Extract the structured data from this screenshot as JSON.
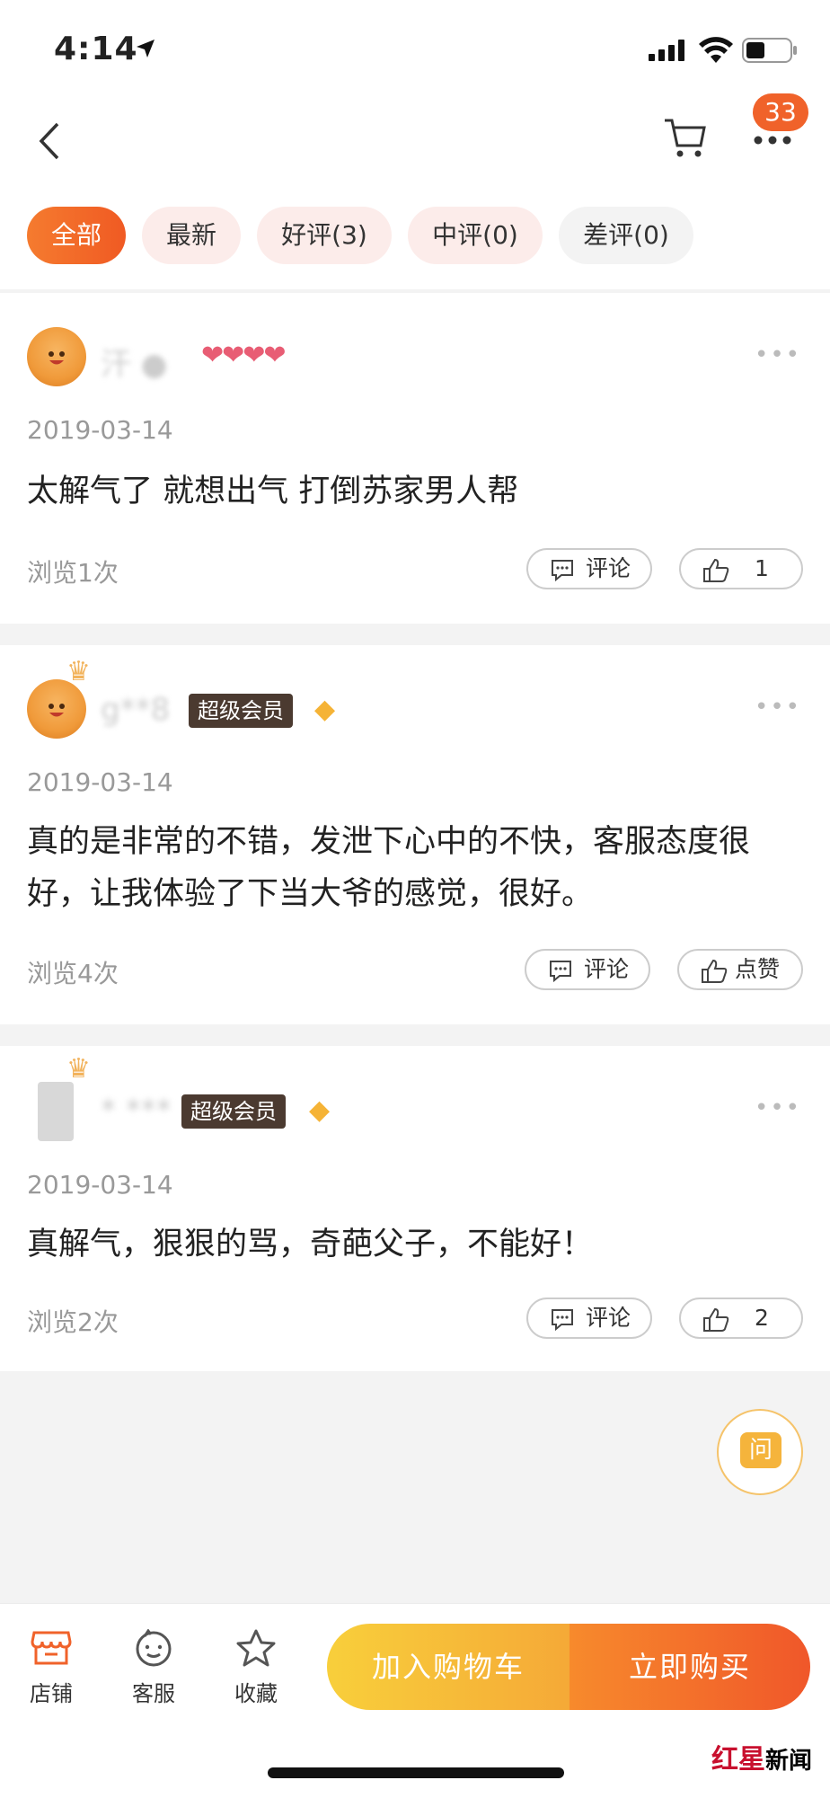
{
  "status": {
    "time": "4:14"
  },
  "nav": {
    "badge": "33"
  },
  "filters": [
    {
      "label": "全部"
    },
    {
      "label": "最新"
    },
    {
      "label": "好评(3)"
    },
    {
      "label": "中评(0)"
    },
    {
      "label": "差评(0)"
    }
  ],
  "reviews": [
    {
      "username": "汗 ●",
      "hearts": "❤❤❤❤",
      "date": "2019-03-14",
      "content": "太解气了 就想出气 打倒苏家男人帮",
      "views": "浏览1次",
      "comment_label": "评论",
      "like_label": "1"
    },
    {
      "username": "g**8",
      "vip": "超级会员",
      "date": "2019-03-14",
      "content": "真的是非常的不错，发泄下心中的不快，客服态度很好，让我体验了下当大爷的感觉，很好。",
      "views": "浏览4次",
      "comment_label": "评论",
      "like_label": "点赞"
    },
    {
      "username": "* ***",
      "vip": "超级会员",
      "date": "2019-03-14",
      "content": "真解气，狠狠的骂，奇葩父子，不能好！",
      "views": "浏览2次",
      "comment_label": "评论",
      "like_label": "2"
    }
  ],
  "ask": {
    "label": "问"
  },
  "bottom": {
    "store": "店铺",
    "service": "客服",
    "favorite": "收藏",
    "add_cart": "加入购物车",
    "buy_now": "立即购买"
  },
  "watermark": {
    "red": "红星",
    "black": "新闻"
  }
}
